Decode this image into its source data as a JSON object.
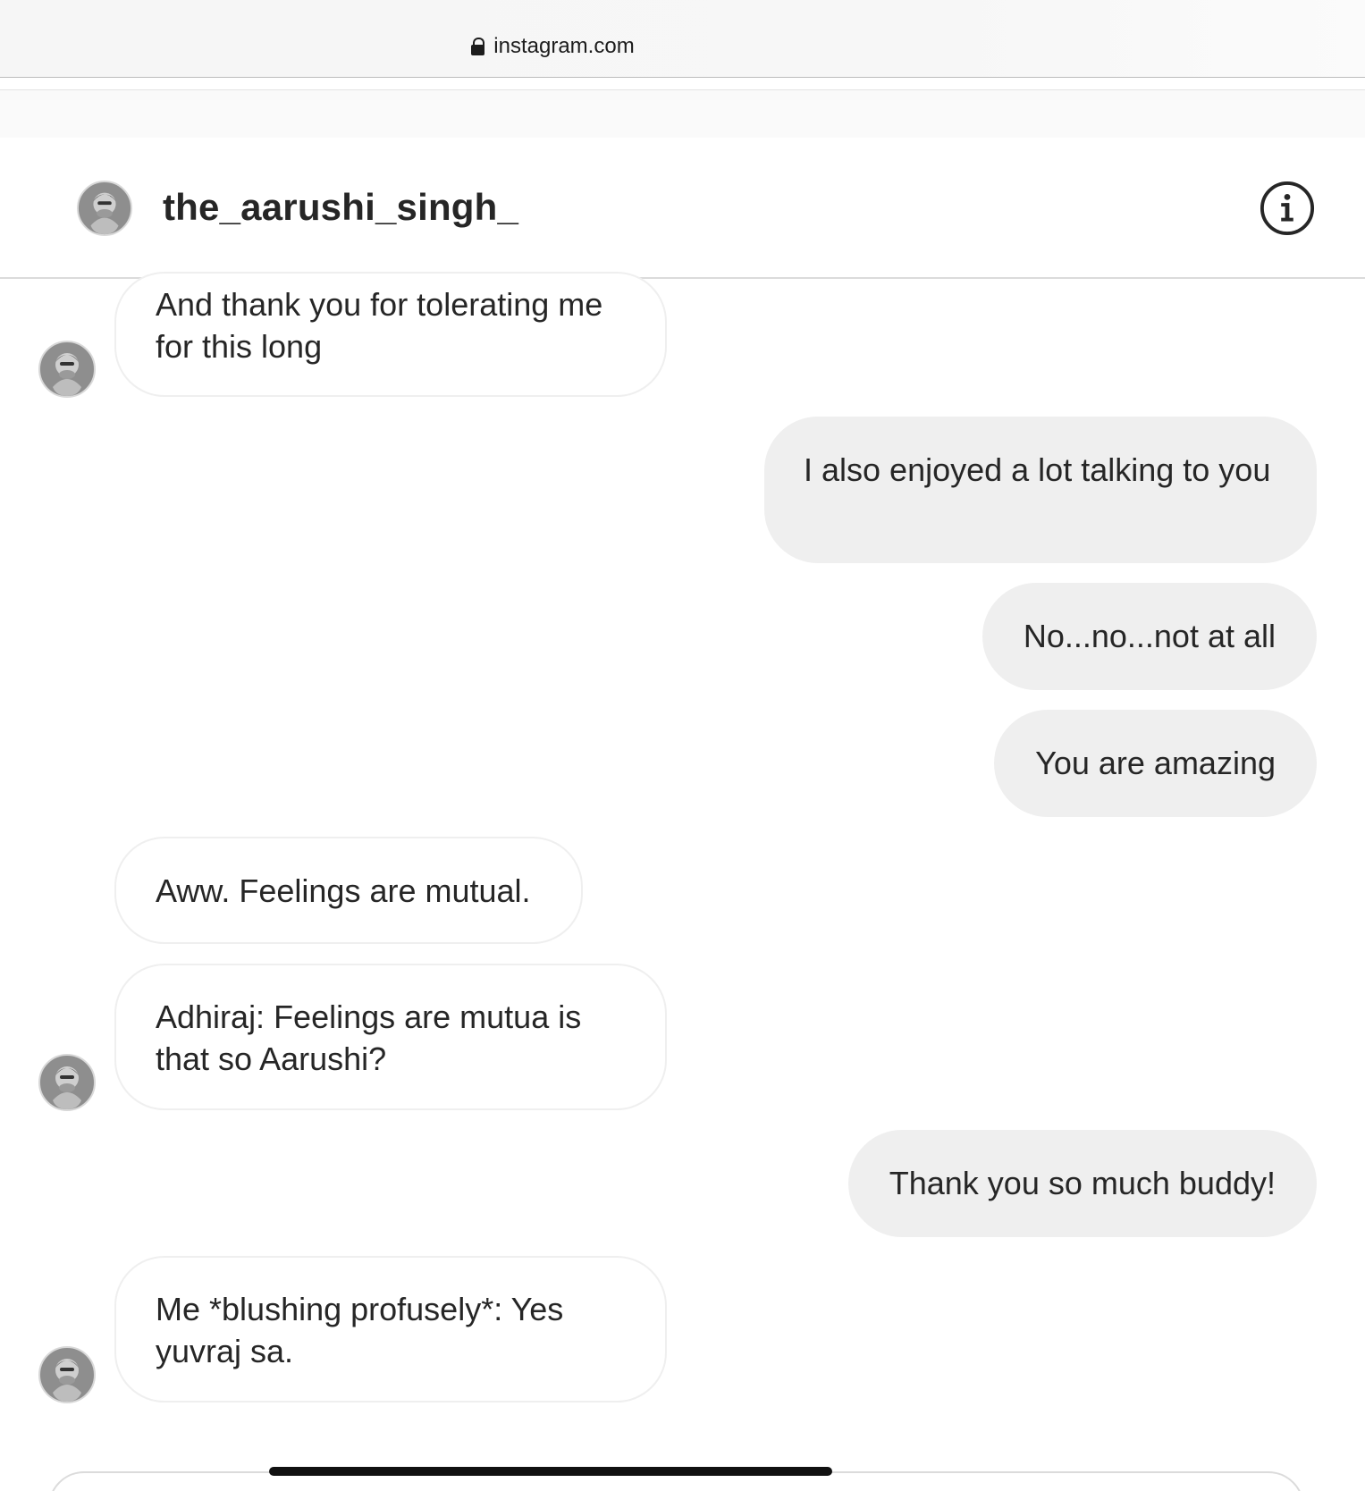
{
  "browser": {
    "url": "instagram.com",
    "lock_icon": "lock-icon"
  },
  "header": {
    "username": "the_aarushi_singh_",
    "info_icon": "info-icon",
    "avatar": "avatar"
  },
  "messages": [
    {
      "direction": "incoming",
      "text": "And thank you for tolerating me for this long",
      "show_avatar": true
    },
    {
      "direction": "outgoing",
      "text": "I also enjoyed a lot talking to you"
    },
    {
      "direction": "outgoing",
      "text": "No...no...not at all"
    },
    {
      "direction": "outgoing",
      "text": "You are amazing"
    },
    {
      "direction": "incoming",
      "text": "Aww. Feelings are mutual.",
      "show_avatar": false
    },
    {
      "direction": "incoming",
      "text": "Adhiraj: Feelings are mutua is that so Aarushi?",
      "show_avatar": true
    },
    {
      "direction": "outgoing",
      "text": "Thank you so much buddy!"
    },
    {
      "direction": "incoming",
      "text": "Me *blushing profusely*: Yes yuvraj sa.",
      "show_avatar": true
    }
  ],
  "colors": {
    "incoming_bubble": "#ffffff",
    "outgoing_bubble": "#efefef",
    "text": "#262626",
    "divider": "#dbdbdb"
  }
}
